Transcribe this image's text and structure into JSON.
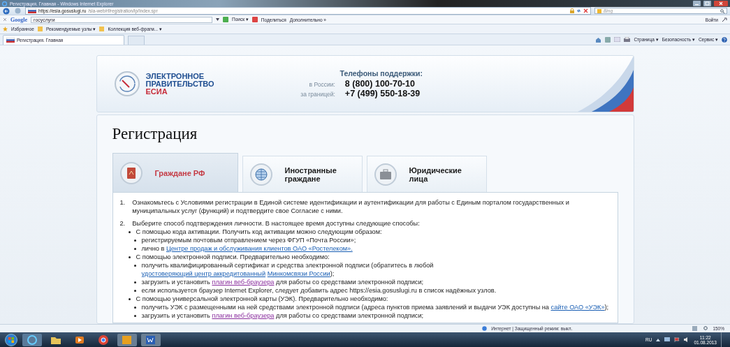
{
  "window": {
    "title": "Регистрация. Главная - Windows Internet Explorer"
  },
  "address_bar": {
    "url_host": "https://esia.gosuslugi.ru",
    "url_path": "/sia-web/rf/registration/lp/Index.spr",
    "search_placeholder": "Bing"
  },
  "google_toolbar": {
    "logo": "Google",
    "query": "госуслуги",
    "buttons": [
      "Поиск ▾",
      "Поделиться",
      "Дополнительно »"
    ],
    "signin": "Войти"
  },
  "favorites_bar": {
    "items": [
      "Избранное",
      "Рекомендуемые узлы ▾",
      "Коллекция веб-фрагм... ▾"
    ]
  },
  "tabs": [
    {
      "label": "Регистрация. Главная",
      "selected": true
    }
  ],
  "command_bar": [
    "Страница ▾",
    "Безопасность ▾",
    "Сервис ▾"
  ],
  "site_header": {
    "logo_lines": [
      "ЭЛЕКТРОННОЕ",
      "ПРАВИТЕЛЬСТВО"
    ],
    "logo_sub": "ЕСИА",
    "support_title": "Телефоны поддержки:",
    "phones": [
      {
        "label": "в России:",
        "number": "8 (800) 100-70-10"
      },
      {
        "label": "за границей:",
        "number": "+7 (499) 550-18-39"
      }
    ]
  },
  "page_title": "Регистрация",
  "user_types": [
    {
      "kind": "citizen",
      "label": "Граждане РФ",
      "selected": true
    },
    {
      "kind": "foreign",
      "label": "Иностранные граждане",
      "selected": false
    },
    {
      "kind": "legal",
      "label": "Юридические лица",
      "selected": false
    }
  ],
  "instructions": [
    {
      "number": "1.",
      "parts": [
        {
          "text": "Ознакомьтесь с Условиями регистрации в Единой системе идентификации и аутентификации для работы с Единым порталом государственных и муниципальных услуг (функций) и подтвердите свое Согласие с ними."
        }
      ]
    },
    {
      "number": "2.",
      "parts": [
        {
          "text": "Выберите способ подтверждения личности. В настоящее время доступны следующие способы:"
        }
      ],
      "children": [
        {
          "parts": [
            {
              "text": "С помощью кода активации. Получить код активации можно следующим образом:"
            }
          ],
          "children": [
            {
              "parts": [
                {
                  "text": "регистрируемым почтовым отправлением через ФГУП «Почта России»;"
                }
              ]
            },
            {
              "parts": [
                {
                  "text": "лично в "
                },
                {
                  "link": "Центре продаж и обслуживания клиентов ОАО «Ростелеком».",
                  "visited": false
                }
              ]
            }
          ]
        },
        {
          "parts": [
            {
              "text": "С помощью электронной подписи. Предварительно необходимо:"
            }
          ],
          "children": [
            {
              "parts": [
                {
                  "text": "получить квалифицированный сертификат и средства электронной подписи (обратитесь в любой "
                },
                {
                  "link": "удостоверяющий центр аккредитованный",
                  "visited": false
                },
                {
                  "link": "Минкомсвязи России",
                  "visited": false
                },
                {
                  "text": ");"
                }
              ]
            },
            {
              "parts": [
                {
                  "text": "загрузить и установить "
                },
                {
                  "link": "плагин веб-браузера",
                  "visited": true
                },
                {
                  "text": " для работы со средствами электронной подписи;"
                }
              ]
            },
            {
              "parts": [
                {
                  "text": "если используется браузер Internet Explorer, следует добавить адрес https://esia.gosuslugi.ru в список надёжных узлов."
                }
              ]
            }
          ]
        },
        {
          "parts": [
            {
              "text": "С помощью универсальной электронной карты (УЭК). Предварительно необходимо:"
            }
          ],
          "children": [
            {
              "parts": [
                {
                  "text": "получить УЭК с размещенными на ней средствами электронной подписи (адреса пунктов приема заявлений и выдачи УЭК доступны на "
                },
                {
                  "link": "сайте ОАО «УЭК»",
                  "visited": false
                },
                {
                  "text": ");"
                }
              ]
            },
            {
              "parts": [
                {
                  "text": "загрузить и установить "
                },
                {
                  "link": "плагин веб-браузера",
                  "visited": true
                },
                {
                  "text": " для работы со средствами электронной подписи;"
                }
              ]
            }
          ]
        }
      ]
    }
  ],
  "status_bar": {
    "zone": "Интернет | Защищенный режим: выкл.",
    "zoom": "150%"
  },
  "taskbar": {
    "language": "RU",
    "time": "11:22",
    "date": "01.08.2013"
  }
}
